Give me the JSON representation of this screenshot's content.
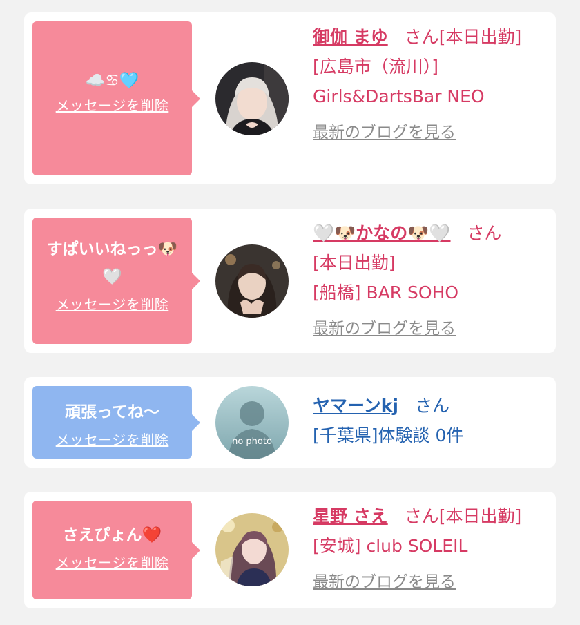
{
  "delete_label": "メッセージを削除",
  "blog_label": "最新のブログを見る",
  "colors": {
    "pink_bubble": "#f68a9a",
    "blue_bubble": "#8fb6f0",
    "cast_text": "#d63a63",
    "user_text": "#2462b0"
  },
  "messages": [
    {
      "bubble_text": "☁️♋︎🩵",
      "name": "御伽 まゆ",
      "suffix": "さん",
      "status": "[本日出勤]",
      "location": "[広島市（流川）] Girls&DartsBar NEO",
      "avatar": "avatar-photo-blonde-girl"
    },
    {
      "bubble_text": "すぱいいねっっ🐶🤍",
      "name": "🤍🐶かなの🐶🤍",
      "suffix": "さん",
      "status": "[本日出勤]",
      "location": "[船橋] BAR SOHO",
      "avatar": "avatar-photo-dark-hair-girl"
    },
    {
      "bubble_text": "頑張ってね〜",
      "name": "ヤマーンkj",
      "suffix": "さん",
      "location": "[千葉県]体験談 0件",
      "avatar_text": "no photo"
    },
    {
      "bubble_text": "さえぴょん❤️",
      "name": "星野 さえ",
      "suffix": "さん",
      "status": "[本日出勤]",
      "location": "[安城] club SOLEIL",
      "avatar": "avatar-photo-gold-background-girl"
    }
  ]
}
